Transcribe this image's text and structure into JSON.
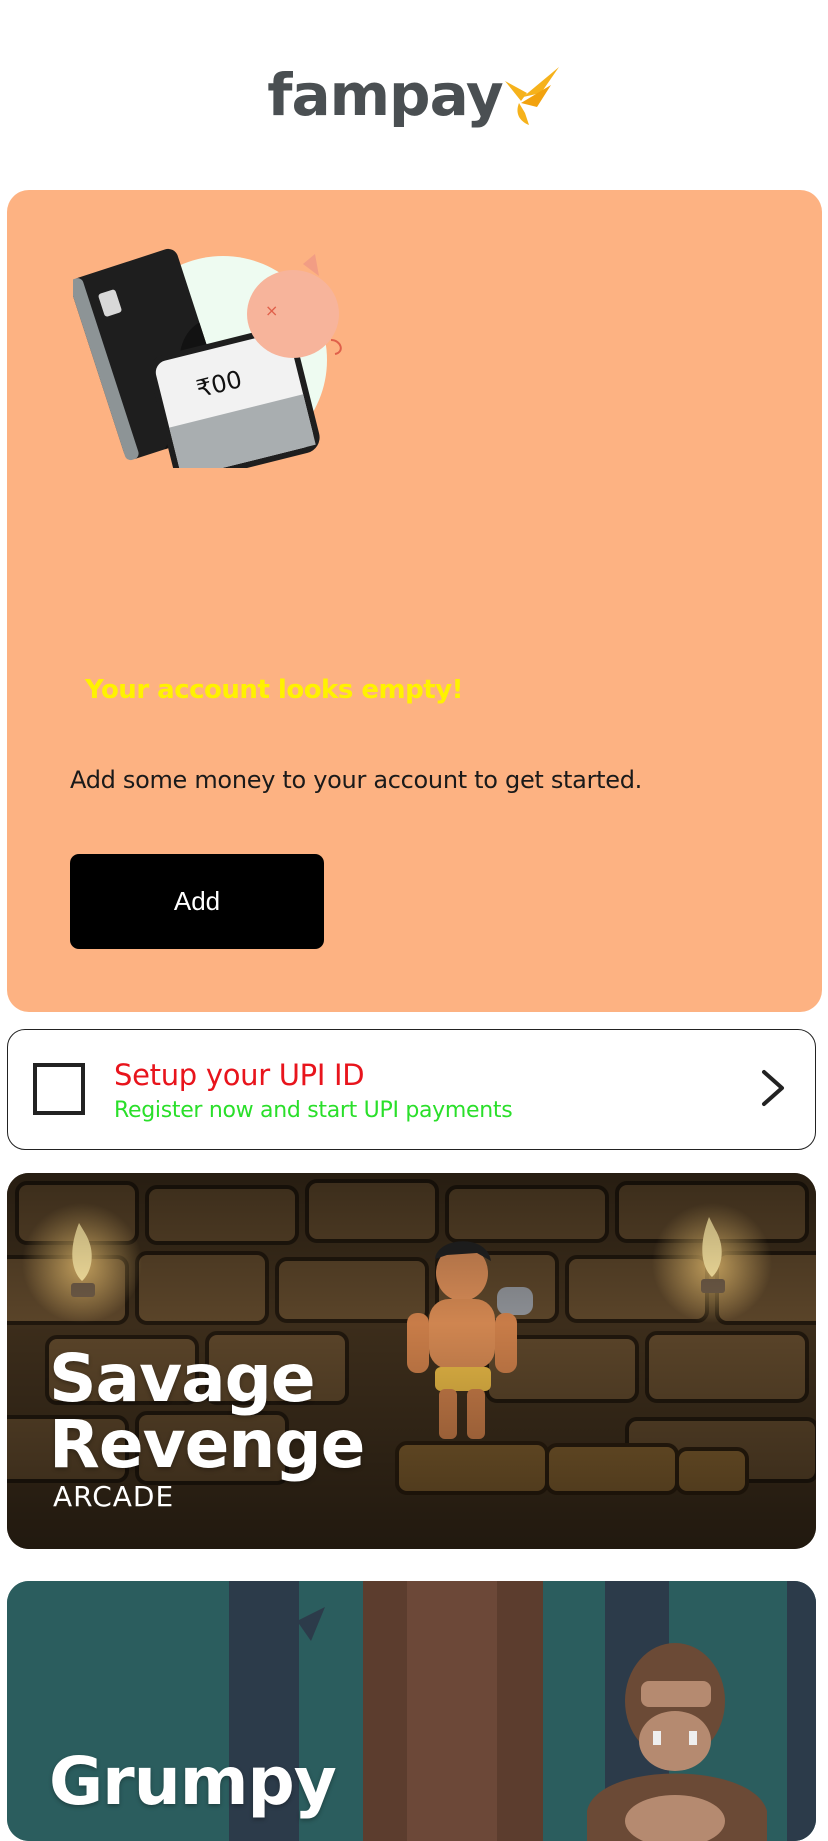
{
  "header": {
    "logo_text": "fampay",
    "logo_icon": "fampay-bird-icon"
  },
  "empty_card": {
    "illustration_amount": "₹00",
    "title": "Your account looks empty!",
    "description": "Add some money to your account to get started.",
    "add_button_label": "Add",
    "colors": {
      "background": "#fdb282",
      "title": "#fff200"
    }
  },
  "upi_card": {
    "title": "Setup your UPI ID",
    "subtitle": "Register now and start UPI payments",
    "chevron_icon": "chevron-right-icon",
    "colors": {
      "title": "#e8141c",
      "subtitle": "#2adf2a"
    }
  },
  "games": [
    {
      "title": "Savage Revenge",
      "genre": "ARCADE"
    },
    {
      "title": "Grumpy"
    }
  ]
}
